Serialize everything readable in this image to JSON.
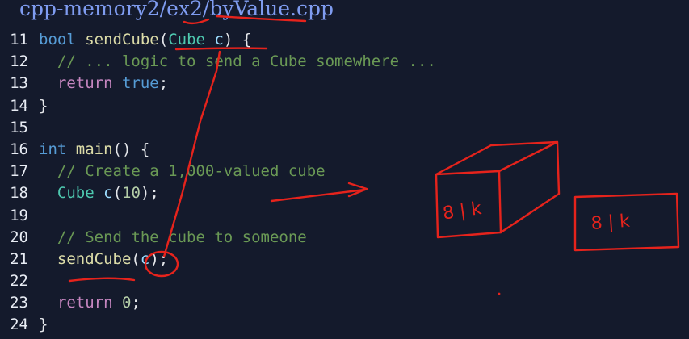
{
  "header": {
    "file_path": "cpp-memory2/ex2/byValue.cpp"
  },
  "code_lines": [
    {
      "num": "11",
      "tokens": [
        {
          "t": "bool",
          "c": "kw"
        },
        {
          "t": " ",
          "c": "pl"
        },
        {
          "t": "sendCube",
          "c": "fn"
        },
        {
          "t": "(",
          "c": "pl"
        },
        {
          "t": "Cube",
          "c": "ty"
        },
        {
          "t": " ",
          "c": "pl"
        },
        {
          "t": "c",
          "c": "var"
        },
        {
          "t": ") {",
          "c": "pl"
        }
      ]
    },
    {
      "num": "12",
      "tokens": [
        {
          "t": "  // ... logic to send a Cube somewhere ...",
          "c": "cm"
        }
      ]
    },
    {
      "num": "13",
      "tokens": [
        {
          "t": "  ",
          "c": "pl"
        },
        {
          "t": "return",
          "c": "ctl"
        },
        {
          "t": " ",
          "c": "pl"
        },
        {
          "t": "true",
          "c": "kw"
        },
        {
          "t": ";",
          "c": "pl"
        }
      ]
    },
    {
      "num": "14",
      "tokens": [
        {
          "t": "}",
          "c": "pl"
        }
      ]
    },
    {
      "num": "15",
      "tokens": []
    },
    {
      "num": "16",
      "tokens": [
        {
          "t": "int",
          "c": "kw"
        },
        {
          "t": " ",
          "c": "pl"
        },
        {
          "t": "main",
          "c": "fn"
        },
        {
          "t": "() {",
          "c": "pl"
        }
      ]
    },
    {
      "num": "17",
      "tokens": [
        {
          "t": "  // Create a 1,000-valued cube",
          "c": "cm"
        }
      ]
    },
    {
      "num": "18",
      "tokens": [
        {
          "t": "  ",
          "c": "pl"
        },
        {
          "t": "Cube",
          "c": "ty"
        },
        {
          "t": " ",
          "c": "pl"
        },
        {
          "t": "c",
          "c": "var"
        },
        {
          "t": "(",
          "c": "pl"
        },
        {
          "t": "10",
          "c": "num"
        },
        {
          "t": ");",
          "c": "pl"
        }
      ]
    },
    {
      "num": "19",
      "tokens": []
    },
    {
      "num": "20",
      "tokens": [
        {
          "t": "  // Send the cube to someone",
          "c": "cm"
        }
      ]
    },
    {
      "num": "21",
      "tokens": [
        {
          "t": "  ",
          "c": "pl"
        },
        {
          "t": "sendCube",
          "c": "fn"
        },
        {
          "t": "(",
          "c": "pl"
        },
        {
          "t": "c",
          "c": "var"
        },
        {
          "t": ");",
          "c": "pl"
        }
      ]
    },
    {
      "num": "22",
      "tokens": []
    },
    {
      "num": "23",
      "tokens": [
        {
          "t": "  ",
          "c": "pl"
        },
        {
          "t": "return",
          "c": "ctl"
        },
        {
          "t": " ",
          "c": "pl"
        },
        {
          "t": "0",
          "c": "num"
        },
        {
          "t": ";",
          "c": "pl"
        }
      ]
    },
    {
      "num": "24",
      "tokens": [
        {
          "t": "}",
          "c": "pl"
        }
      ]
    }
  ],
  "annotations": {
    "cube_label": "8 | k",
    "box_label": "8 | k"
  },
  "colors": {
    "background": "#141a2c",
    "keyword": "#569cd6",
    "function": "#dcdca8",
    "type": "#4ec9b0",
    "comment": "#6a9955",
    "control": "#c586c0",
    "number": "#b5cea8",
    "variable": "#9cdcfe",
    "ink": "#e6231c"
  }
}
